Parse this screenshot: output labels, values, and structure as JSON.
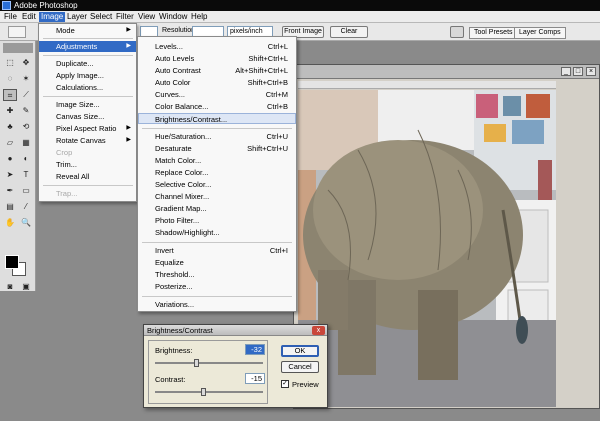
{
  "app": {
    "title": "Adobe Photoshop"
  },
  "menubar": [
    "File",
    "Edit",
    "Image",
    "Layer",
    "Select",
    "Filter",
    "View",
    "Window",
    "Help"
  ],
  "options_bar": {
    "resolution_label": "Resolution:",
    "units_value": "pixels/inch",
    "front_image_label": "Front Image",
    "clear_label": "Clear",
    "tabs": [
      "Tool Presets",
      "Layer Comps"
    ]
  },
  "image_menu": {
    "mode": "Mode",
    "adjustments": "Adjustments",
    "duplicate": "Duplicate...",
    "apply_image": "Apply Image...",
    "calculations": "Calculations...",
    "image_size": "Image Size...",
    "canvas_size": "Canvas Size...",
    "pixel_aspect": "Pixel Aspect Ratio",
    "rotate_canvas": "Rotate Canvas",
    "crop": "Crop",
    "trim": "Trim...",
    "reveal_all": "Reveal All",
    "trap": "Trap..."
  },
  "adjustments_menu": {
    "levels": {
      "label": "Levels...",
      "shortcut": "Ctrl+L"
    },
    "auto_levels": {
      "label": "Auto Levels",
      "shortcut": "Shift+Ctrl+L"
    },
    "auto_contrast": {
      "label": "Auto Contrast",
      "shortcut": "Alt+Shift+Ctrl+L"
    },
    "auto_color": {
      "label": "Auto Color",
      "shortcut": "Shift+Ctrl+B"
    },
    "curves": {
      "label": "Curves...",
      "shortcut": "Ctrl+M"
    },
    "color_balance": {
      "label": "Color Balance...",
      "shortcut": "Ctrl+B"
    },
    "brightness_contrast": {
      "label": "Brightness/Contrast..."
    },
    "hue_saturation": {
      "label": "Hue/Saturation...",
      "shortcut": "Ctrl+U"
    },
    "desaturate": {
      "label": "Desaturate",
      "shortcut": "Shift+Ctrl+U"
    },
    "match_color": {
      "label": "Match Color..."
    },
    "replace_color": {
      "label": "Replace Color..."
    },
    "selective_color": {
      "label": "Selective Color..."
    },
    "channel_mixer": {
      "label": "Channel Mixer..."
    },
    "gradient_map": {
      "label": "Gradient Map..."
    },
    "photo_filter": {
      "label": "Photo Filter..."
    },
    "shadow_highlight": {
      "label": "Shadow/Highlight..."
    },
    "invert": {
      "label": "Invert",
      "shortcut": "Ctrl+I"
    },
    "equalize": {
      "label": "Equalize"
    },
    "threshold": {
      "label": "Threshold..."
    },
    "posterize": {
      "label": "Posterize..."
    },
    "variations": {
      "label": "Variations..."
    }
  },
  "dialog": {
    "title": "Brightness/Contrast",
    "close": "x",
    "brightness_label": "Brightness:",
    "brightness_value": "-32",
    "contrast_label": "Contrast:",
    "contrast_value": "-15",
    "ok": "OK",
    "cancel": "Cancel",
    "preview": "Preview",
    "preview_checked": true
  },
  "colors": {
    "menu_highlight": "#316ac5",
    "foreground": "#000000",
    "background": "#ffffff"
  },
  "icons": [
    "minimize-icon",
    "maximize-icon",
    "close-icon",
    "submenu-arrow-icon",
    "checkmark-icon",
    "printer-icon"
  ]
}
